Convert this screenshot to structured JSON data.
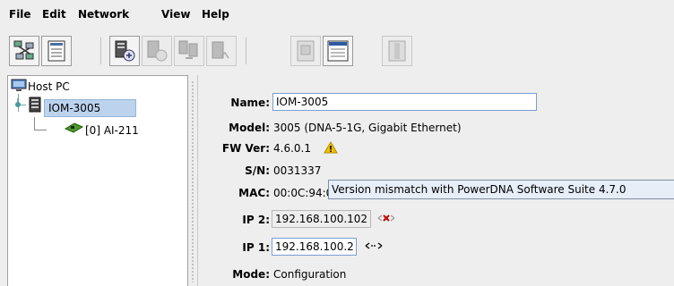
{
  "menu": {
    "items": [
      {
        "label": "File"
      },
      {
        "label": "Edit"
      },
      {
        "label": "Network"
      },
      {
        "label": "View"
      },
      {
        "label": "Help"
      }
    ]
  },
  "toolbar": {
    "icons": [
      "network-scan-icon",
      "properties-icon",
      "add-device-icon",
      "reconnect-icon",
      "copy-config-icon",
      "firmware-icon",
      "document-icon",
      "window-icon",
      "panel-icon"
    ]
  },
  "tree": {
    "root": "Host PC",
    "device": "IOM-3005",
    "layer": "[0] AI-211"
  },
  "details": {
    "name_label": "Name:",
    "name_value": "IOM-3005",
    "model_label": "Model:",
    "model_value": "3005 (DNA-5-1G, Gigabit Ethernet)",
    "fw_label": "FW Ver:",
    "fw_value": "4.6.0.1",
    "sn_label": "S/N:",
    "sn_value": "0031337",
    "mac_label": "MAC:",
    "mac_value": "00:0C:94:00:00:7A",
    "ip2_label": "IP 2:",
    "ip2_value": "192.168.100.102",
    "ip1_label": "IP 1:",
    "ip1_value": "192.168.100.2",
    "mode_label": "Mode:",
    "mode_value": "Configuration"
  },
  "tooltip": "Version mismatch with PowerDNA Software Suite 4.7.0",
  "colors": {
    "selection": "#bcd3ee",
    "warning": "#f2c200",
    "error": "#c00000",
    "field_border": "#7a9cd3"
  }
}
